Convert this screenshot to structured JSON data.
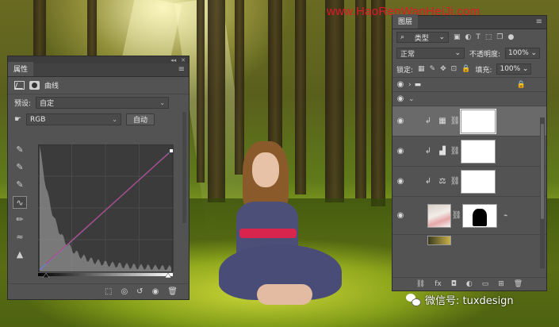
{
  "watermark": "www.HaoRenWanHeiJi.com",
  "wechat": {
    "text": "微信号: tuxdesign"
  },
  "properties": {
    "tab": "属性",
    "adjustment_title": "曲线",
    "preset_label": "预设:",
    "preset_value": "自定",
    "channel_value": "RGB",
    "auto_button": "自动",
    "curve": {
      "input_range": [
        0,
        255
      ],
      "output_range": [
        0,
        255
      ],
      "points": [
        [
          0,
          0
        ],
        [
          255,
          255
        ]
      ]
    }
  },
  "layers": {
    "tab": "图层",
    "filter_type": "类型",
    "blend_mode": "正常",
    "opacity_label": "不透明度:",
    "opacity_value": "100%",
    "lock_label": "锁定:",
    "fill_label": "填充:",
    "fill_value": "100%",
    "rows": [
      {
        "kind": "curves",
        "icon": "curves-adjustment-icon"
      },
      {
        "kind": "levels",
        "icon": "levels-adjustment-icon"
      },
      {
        "kind": "color-balance",
        "icon": "balance-adjustment-icon"
      }
    ]
  },
  "colors": {
    "panel": "#535353",
    "accent_watermark": "#e0182b",
    "belt": "#d8254e"
  }
}
